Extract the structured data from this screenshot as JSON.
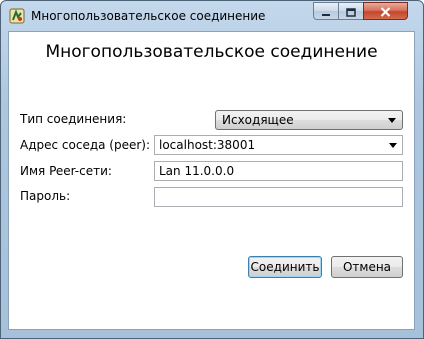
{
  "window": {
    "title": "Многопользовательское соединение"
  },
  "dialog": {
    "heading": "Многопользовательское соединение"
  },
  "form": {
    "connection_type": {
      "label": "Тип соединения:",
      "value": "Исходящее"
    },
    "peer_address": {
      "label": "Адрес соседа (peer):",
      "value": "localhost:38001"
    },
    "peer_network_name": {
      "label": "Имя Peer-сети:",
      "value": "Lan 11.0.0.0"
    },
    "password": {
      "label": "Пароль:",
      "value": ""
    }
  },
  "buttons": {
    "connect": "Соединить",
    "cancel": "Отмена"
  },
  "icons": {
    "app": "app-icon",
    "minimize": "minimize-icon",
    "maximize": "maximize-icon",
    "close": "close-icon",
    "dropdown": "chevron-down-icon"
  },
  "colors": {
    "title_bar": "#a7c1da",
    "close_button": "#c4462c",
    "default_button_border": "#3c7fb1"
  }
}
